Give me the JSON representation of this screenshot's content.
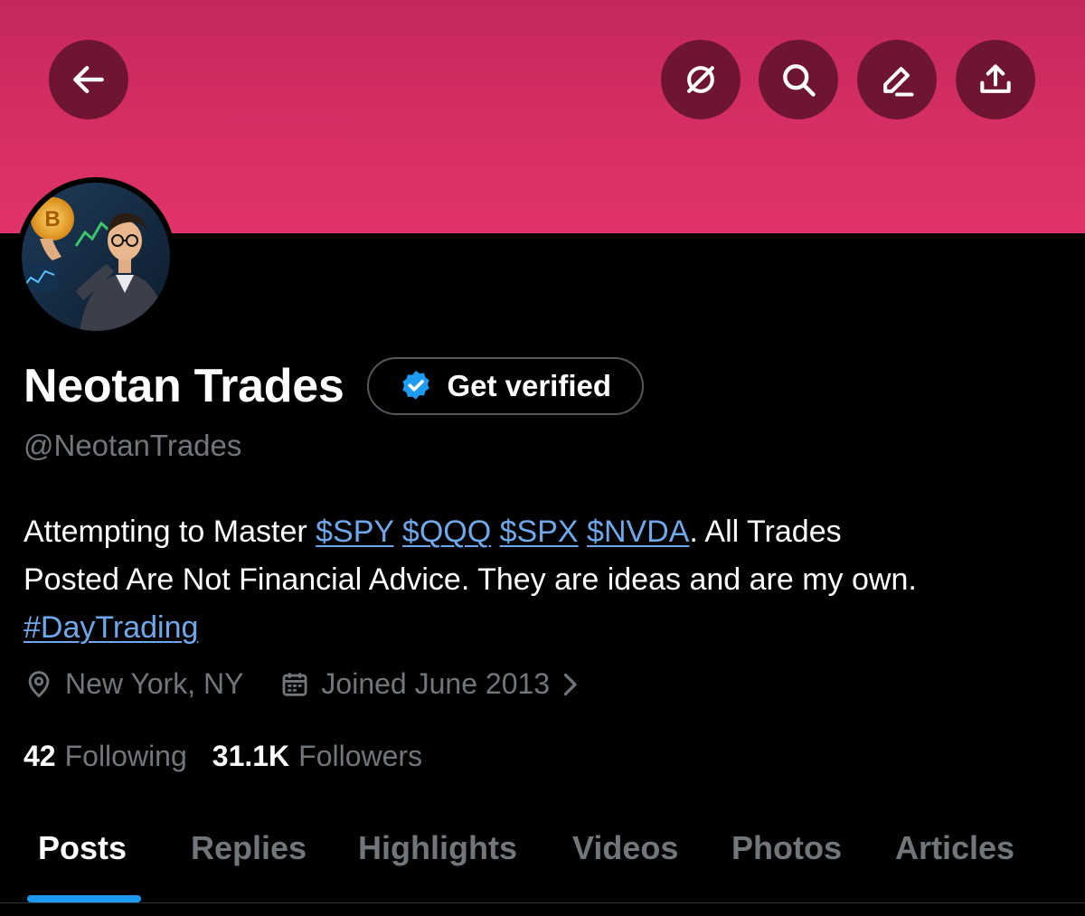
{
  "header": {
    "buttons": [
      {
        "name": "back",
        "icon": "arrow-left-icon"
      },
      {
        "name": "no-circle",
        "icon": "slashed-circle-icon"
      },
      {
        "name": "search",
        "icon": "search-icon"
      },
      {
        "name": "edit",
        "icon": "pencil-icon"
      },
      {
        "name": "share",
        "icon": "upload-icon"
      }
    ],
    "banner_color": "#d62f64",
    "button_color": "#6e1631"
  },
  "profile": {
    "display_name": "Neotan Trades",
    "handle": "@NeotanTrades",
    "verify_button_label": "Get verified",
    "bio": {
      "line1_prefix": "Attempting to Master ",
      "tickers": [
        "$SPY",
        "$QQQ",
        "$SPX",
        "$NVDA"
      ],
      "line1_suffix": ". All Trades",
      "line2": "Posted Are Not Financial Advice. They are ideas and are my own.",
      "hashtag": "#DayTrading"
    },
    "location": "New York, NY",
    "joined": "Joined June 2013",
    "following_count": "42",
    "following_label": "Following",
    "followers_count": "31.1K",
    "followers_label": "Followers"
  },
  "tabs": [
    {
      "label": "Posts",
      "active": true
    },
    {
      "label": "Replies",
      "active": false
    },
    {
      "label": "Highlights",
      "active": false
    },
    {
      "label": "Videos",
      "active": false
    },
    {
      "label": "Photos",
      "active": false
    },
    {
      "label": "Articles",
      "active": false
    }
  ],
  "colors": {
    "link": "#6fa8ea",
    "verified_badge": "#1d9bf0",
    "muted_text": "#71767b",
    "tab_indicator": "#1d9bf0"
  }
}
